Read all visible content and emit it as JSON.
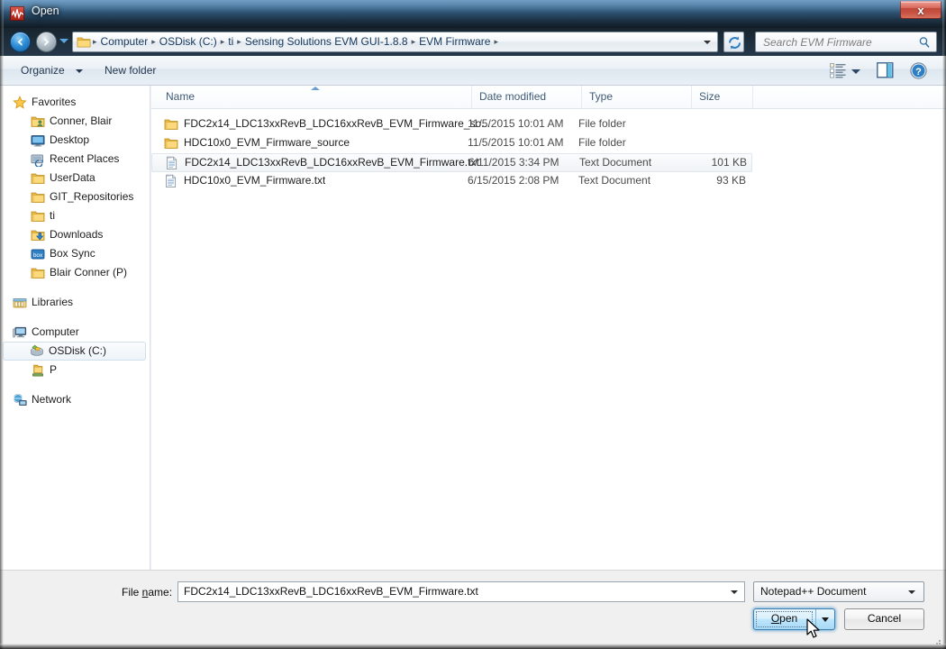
{
  "window": {
    "title": "Open",
    "title_icon": "notepadpp-icon",
    "close_label": "x"
  },
  "address_bar": {
    "back_icon": "back-arrow-icon",
    "forward_icon": "forward-arrow-icon",
    "history_icon": "chevron-down-icon",
    "folder_icon": "folder-icon",
    "breadcrumb": [
      "Computer",
      "OSDisk (C:)",
      "ti",
      "Sensing Solutions EVM GUI-1.8.8",
      "EVM Firmware"
    ],
    "separator": "▸",
    "dropdown_icon": "chevron-down-icon",
    "refresh_icon": "refresh-icon",
    "search": {
      "placeholder": "Search EVM Firmware",
      "icon": "search-icon"
    }
  },
  "toolbar": {
    "organize_label": "Organize",
    "organize_arrow_icon": "chevron-down-icon",
    "new_folder_label": "New folder",
    "view_icon": "view-list-icon",
    "view_arrow_icon": "chevron-down-icon",
    "preview_icon": "preview-pane-icon",
    "help_icon": "help-icon"
  },
  "nav_pane": {
    "groups": [
      {
        "header": {
          "label": "Favorites",
          "icon": "star-icon"
        },
        "items": [
          {
            "label": "Conner, Blair",
            "icon": "user-folder-icon",
            "selected": false
          },
          {
            "label": "Desktop",
            "icon": "desktop-icon",
            "selected": false
          },
          {
            "label": "Recent Places",
            "icon": "recent-places-icon",
            "selected": false
          },
          {
            "label": "UserData",
            "icon": "folder-icon",
            "selected": false
          },
          {
            "label": "GIT_Repositories",
            "icon": "folder-icon",
            "selected": false
          },
          {
            "label": "ti",
            "icon": "folder-icon",
            "selected": false
          },
          {
            "label": "Downloads",
            "icon": "downloads-folder-icon",
            "selected": false
          },
          {
            "label": "Box Sync",
            "icon": "box-sync-icon",
            "selected": false
          },
          {
            "label": "Blair Conner (P)",
            "icon": "folder-icon",
            "selected": false
          }
        ]
      },
      {
        "header": {
          "label": "Libraries",
          "icon": "libraries-icon"
        },
        "items": []
      },
      {
        "header": {
          "label": "Computer",
          "icon": "computer-icon"
        },
        "items": [
          {
            "label": "OSDisk (C:)",
            "icon": "harddisk-icon",
            "selected": true
          },
          {
            "label": "P",
            "icon": "network-drive-icon",
            "selected": false
          }
        ]
      },
      {
        "header": {
          "label": "Network",
          "icon": "network-icon"
        },
        "items": []
      }
    ]
  },
  "file_list": {
    "columns": [
      {
        "key": "name",
        "label": "Name",
        "sorted": "asc"
      },
      {
        "key": "date",
        "label": "Date modified"
      },
      {
        "key": "type",
        "label": "Type"
      },
      {
        "key": "size",
        "label": "Size"
      }
    ],
    "sort_indicator_icon": "sort-ascending-icon",
    "rows": [
      {
        "name": "FDC2x14_LDC13xxRevB_LDC16xxRevB_EVM_Firmware_so...",
        "date": "11/5/2015 10:01 AM",
        "type": "File folder",
        "size": "",
        "icon": "folder-icon",
        "selected": false
      },
      {
        "name": "HDC10x0_EVM_Firmware_source",
        "date": "11/5/2015 10:01 AM",
        "type": "File folder",
        "size": "",
        "icon": "folder-icon",
        "selected": false
      },
      {
        "name": "FDC2x14_LDC13xxRevB_LDC16xxRevB_EVM_Firmware.txt",
        "date": "6/11/2015 3:34 PM",
        "type": "Text Document",
        "size": "101 KB",
        "icon": "text-document-icon",
        "selected": true
      },
      {
        "name": "HDC10x0_EVM_Firmware.txt",
        "date": "6/15/2015 2:08 PM",
        "type": "Text Document",
        "size": "93 KB",
        "icon": "text-document-icon",
        "selected": false
      }
    ]
  },
  "footer": {
    "file_name_label_pre": "File ",
    "file_name_label_key": "n",
    "file_name_label_post": "ame:",
    "file_name_value": "FDC2x14_LDC13xxRevB_LDC16xxRevB_EVM_Firmware.txt",
    "file_name_dropdown_icon": "chevron-down-icon",
    "filter_value": "Notepad++ Document",
    "filter_dropdown_icon": "chevron-down-icon",
    "open_label_key": "O",
    "open_label_rest": "pen",
    "open_split_icon": "chevron-down-icon",
    "cancel_label": "Cancel",
    "resize_grip_icon": "resize-grip-icon",
    "cursor_icon": "mouse-pointer-icon"
  },
  "colors": {
    "title_bar": "#1d3448",
    "accent_blue": "#3c7fb1",
    "close_red": "#c1392b",
    "selection_fill": "#f0f3f6",
    "header_text": "#3f5b78"
  }
}
